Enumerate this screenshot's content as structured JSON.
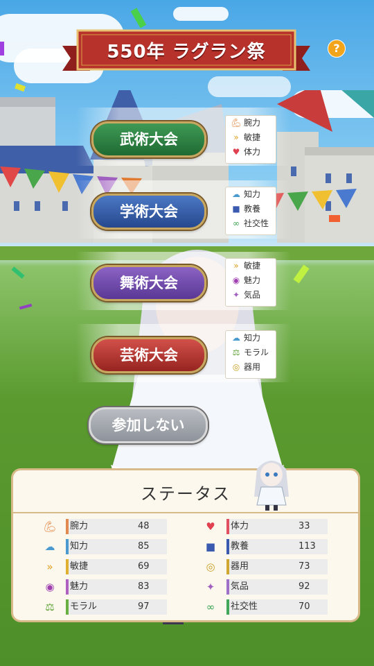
{
  "title": "550年 ラグラン祭",
  "help_label": "?",
  "colors": {
    "banner_red": "#b8322c",
    "panel_border": "#d7b98a",
    "gold_border": "#c8a860"
  },
  "contests": [
    {
      "label": "武術大会",
      "attrs": [
        {
          "icon": "arm-icon",
          "label": "腕力"
        },
        {
          "icon": "agility-icon",
          "label": "敏捷"
        },
        {
          "icon": "heart-icon",
          "label": "体力"
        }
      ]
    },
    {
      "label": "学術大会",
      "attrs": [
        {
          "icon": "brain-icon",
          "label": "知力"
        },
        {
          "icon": "book-icon",
          "label": "教養"
        },
        {
          "icon": "handshake-icon",
          "label": "社交性"
        }
      ]
    },
    {
      "label": "舞術大会",
      "attrs": [
        {
          "icon": "agility-icon",
          "label": "敏捷"
        },
        {
          "icon": "lips-icon",
          "label": "魅力"
        },
        {
          "icon": "sparkle-icon",
          "label": "気品"
        }
      ]
    },
    {
      "label": "芸術大会",
      "attrs": [
        {
          "icon": "brain-icon",
          "label": "知力"
        },
        {
          "icon": "scales-icon",
          "label": "モラル"
        },
        {
          "icon": "target-icon",
          "label": "器用"
        }
      ]
    }
  ],
  "decline_label": "参加しない",
  "status": {
    "title": "ステータス",
    "left": [
      {
        "icon": "arm-icon",
        "label": "腕力",
        "value": "48"
      },
      {
        "icon": "brain-icon",
        "label": "知力",
        "value": "85"
      },
      {
        "icon": "agility-icon",
        "label": "敏捷",
        "value": "69"
      },
      {
        "icon": "lips-icon",
        "label": "魅力",
        "value": "83"
      },
      {
        "icon": "scales-icon",
        "label": "モラル",
        "value": "97"
      }
    ],
    "right": [
      {
        "icon": "heart-icon",
        "label": "体力",
        "value": "33"
      },
      {
        "icon": "book-icon",
        "label": "教養",
        "value": "113"
      },
      {
        "icon": "target-icon",
        "label": "器用",
        "value": "73"
      },
      {
        "icon": "sparkle-icon",
        "label": "気品",
        "value": "92"
      },
      {
        "icon": "handshake-icon",
        "label": "社交性",
        "value": "70"
      }
    ]
  }
}
